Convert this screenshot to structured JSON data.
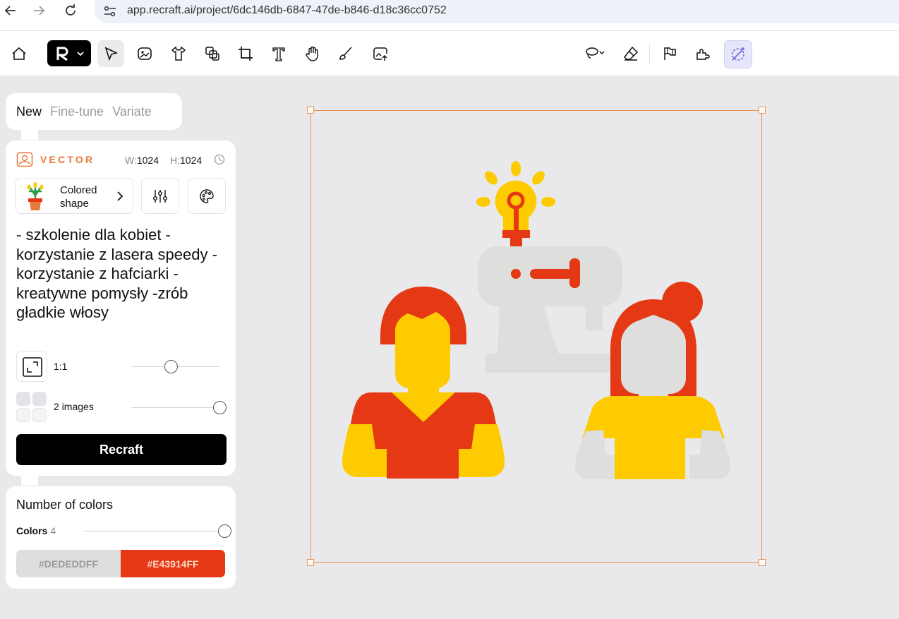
{
  "browser": {
    "url": "app.recraft.ai/project/6dc146db-6847-47de-b846-d18c36cc0752",
    "back_icon": "back-arrow-icon",
    "forward_icon": "forward-arrow-icon",
    "reload_icon": "reload-icon",
    "site_info_icon": "site-settings-icon"
  },
  "toolbar": {
    "left_tools": [
      "home-icon",
      "select-pointer-icon",
      "image-icon",
      "tshirt-mockup-icon",
      "layers-icon",
      "crop-frame-icon",
      "text-icon",
      "hand-icon",
      "brush-icon",
      "upload-image-icon"
    ],
    "right_tools": [
      "lasso-icon",
      "eraser-icon",
      "flags-icon",
      "puzzle-icon",
      "magic-wand-icon"
    ]
  },
  "tabs": [
    {
      "label": "New",
      "active": true
    },
    {
      "label": "Fine-tune",
      "active": false
    },
    {
      "label": "Variate",
      "active": false
    }
  ],
  "settings": {
    "mode_label": "VECTOR",
    "width_key": "W:",
    "width_value": "1024",
    "height_key": "H:",
    "height_value": "1024",
    "style_label_line1": "Colored",
    "style_label_line2": "shape",
    "prompt": "- szkolenie dla kobiet - korzystanie z lasera speedy - korzystanie z hafciarki -kreatywne pomysły -zrób gładkie włosy",
    "aspect_label": "1:1",
    "aspect_level": 0.45,
    "images_label": "2 images",
    "images_level": 1.0,
    "generate_label": "Recraft"
  },
  "colors_panel": {
    "title": "Number of colors",
    "colors_key": "Colors",
    "colors_count": "4",
    "colors_level": 1.0,
    "swatches": [
      {
        "label": "#DEDEDDFF",
        "bg": "#DEDEDD",
        "fg": "#9a9a9a"
      },
      {
        "label": "#E43914FF",
        "bg": "#E43914",
        "fg": "#ffd6c9"
      }
    ]
  },
  "palette": {
    "accent": "#F08C4A",
    "red": "#E43914",
    "yellow": "#FDCB00",
    "grey": "#DEDEDD"
  }
}
